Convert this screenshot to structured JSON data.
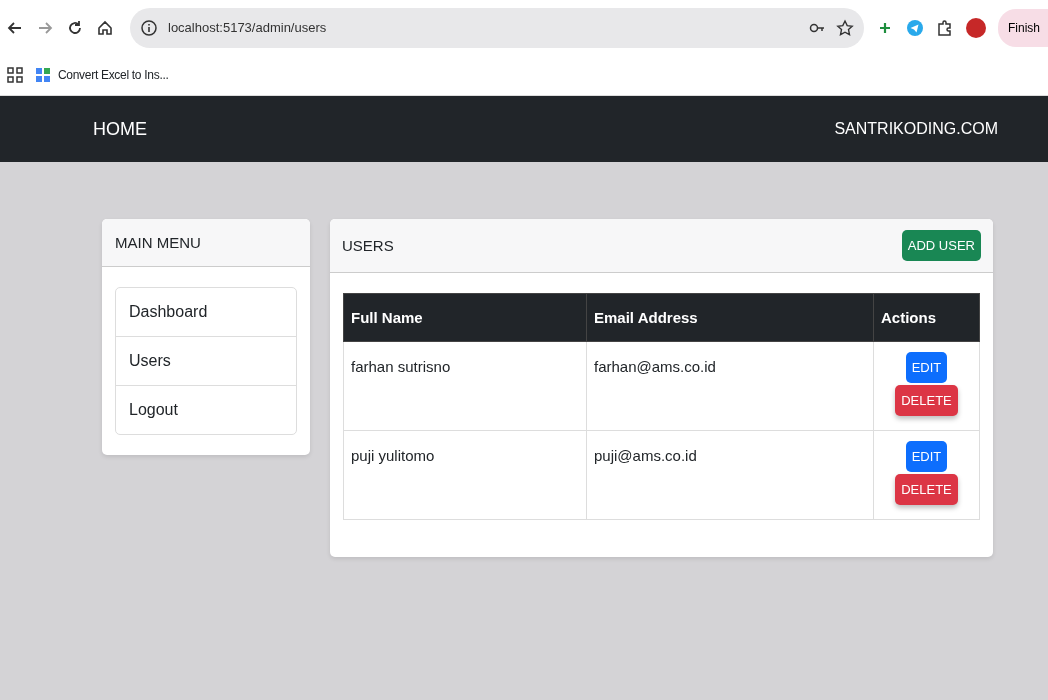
{
  "browser": {
    "url": "localhost:5173/admin/users",
    "profile_button": "Finish",
    "bookmarks": [
      {
        "label": "Convert Excel to Ins..."
      }
    ]
  },
  "navbar": {
    "brand": "HOME",
    "link": "SANTRIKODING.COM"
  },
  "sidebar": {
    "title": "MAIN MENU",
    "items": [
      {
        "label": "Dashboard"
      },
      {
        "label": "Users"
      },
      {
        "label": "Logout"
      }
    ]
  },
  "users_panel": {
    "title": "USERS",
    "add_button": "ADD USER",
    "table": {
      "columns": [
        "Full Name",
        "Email Address",
        "Actions"
      ],
      "rows": [
        {
          "name": "farhan sutrisno",
          "email": "farhan@ams.co.id",
          "actions": [
            "EDIT",
            "DELETE"
          ]
        },
        {
          "name": "puji yulitomo",
          "email": "puji@ams.co.id",
          "actions": [
            "EDIT",
            "DELETE"
          ]
        }
      ]
    }
  }
}
